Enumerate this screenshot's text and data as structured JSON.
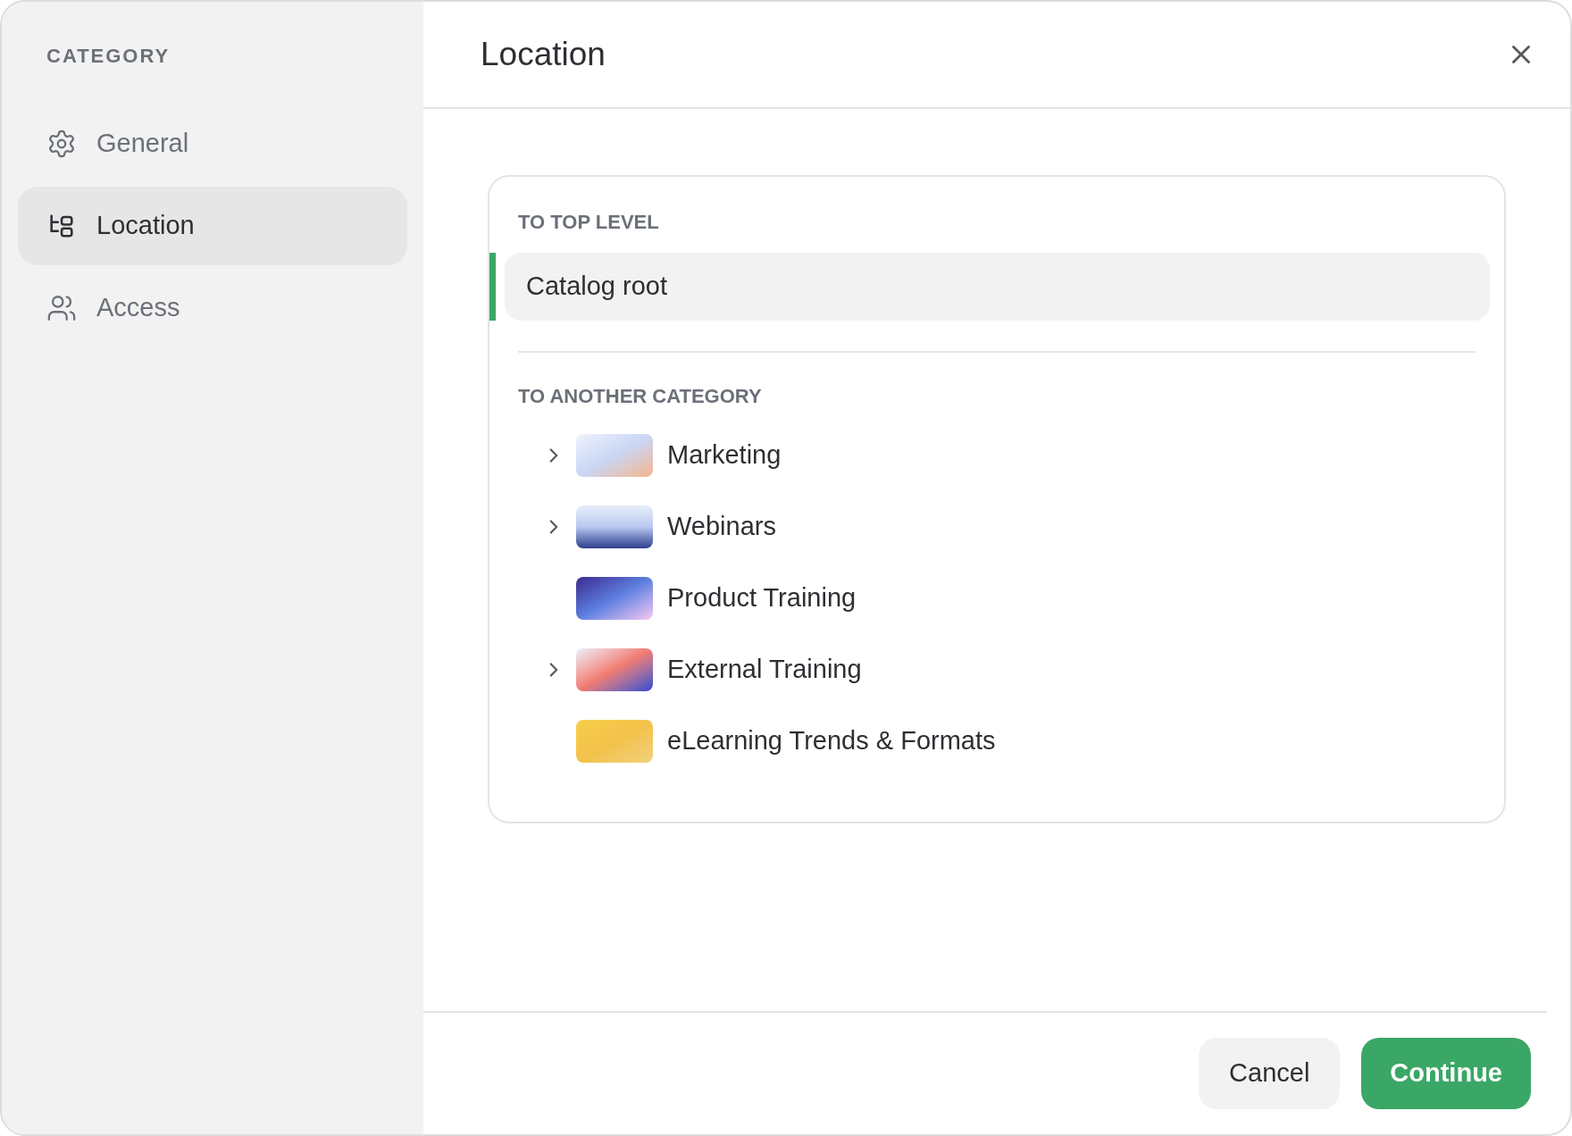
{
  "sidebar": {
    "heading": "CATEGORY",
    "items": [
      {
        "label": "General",
        "kind": "gear",
        "selected": false
      },
      {
        "label": "Location",
        "kind": "tree",
        "selected": true
      },
      {
        "label": "Access",
        "kind": "users",
        "selected": false
      }
    ]
  },
  "dialog": {
    "title": "Location"
  },
  "top_level": {
    "heading": "TO TOP LEVEL",
    "items": [
      {
        "label": "Catalog root",
        "selected": true
      }
    ]
  },
  "another_category": {
    "heading": "TO ANOTHER CATEGORY",
    "items": [
      {
        "label": "Marketing",
        "kind": "branch",
        "selected": false
      },
      {
        "label": "Webinars",
        "kind": "branch",
        "selected": false
      },
      {
        "label": "Product Training",
        "kind": "leaf",
        "selected": false
      },
      {
        "label": "External Training",
        "kind": "branch",
        "selected": false
      },
      {
        "label": "eLearning Trends & Formats",
        "kind": "leaf",
        "selected": false
      }
    ]
  },
  "buttons": [
    {
      "label": "Cancel",
      "kind": "secondary"
    },
    {
      "label": "Continue",
      "kind": "primary"
    }
  ]
}
